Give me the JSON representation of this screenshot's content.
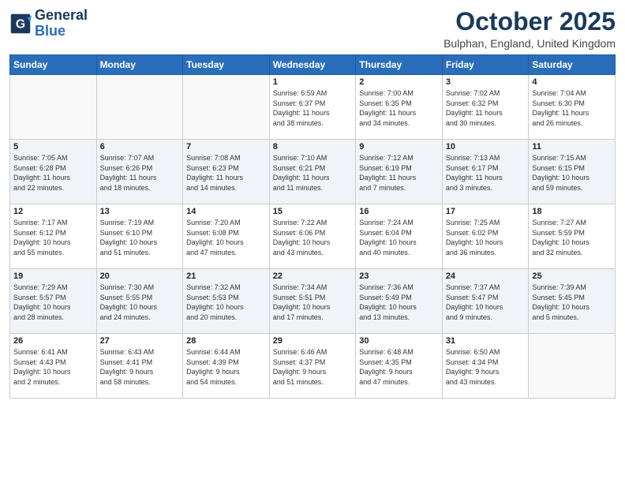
{
  "header": {
    "logo_line1": "General",
    "logo_line2": "Blue",
    "month": "October 2025",
    "location": "Bulphan, England, United Kingdom"
  },
  "weekdays": [
    "Sunday",
    "Monday",
    "Tuesday",
    "Wednesday",
    "Thursday",
    "Friday",
    "Saturday"
  ],
  "weeks": [
    [
      {
        "day": "",
        "info": ""
      },
      {
        "day": "",
        "info": ""
      },
      {
        "day": "",
        "info": ""
      },
      {
        "day": "1",
        "info": "Sunrise: 6:59 AM\nSunset: 6:37 PM\nDaylight: 11 hours\nand 38 minutes."
      },
      {
        "day": "2",
        "info": "Sunrise: 7:00 AM\nSunset: 6:35 PM\nDaylight: 11 hours\nand 34 minutes."
      },
      {
        "day": "3",
        "info": "Sunrise: 7:02 AM\nSunset: 6:32 PM\nDaylight: 11 hours\nand 30 minutes."
      },
      {
        "day": "4",
        "info": "Sunrise: 7:04 AM\nSunset: 6:30 PM\nDaylight: 11 hours\nand 26 minutes."
      }
    ],
    [
      {
        "day": "5",
        "info": "Sunrise: 7:05 AM\nSunset: 6:28 PM\nDaylight: 11 hours\nand 22 minutes."
      },
      {
        "day": "6",
        "info": "Sunrise: 7:07 AM\nSunset: 6:26 PM\nDaylight: 11 hours\nand 18 minutes."
      },
      {
        "day": "7",
        "info": "Sunrise: 7:08 AM\nSunset: 6:23 PM\nDaylight: 11 hours\nand 14 minutes."
      },
      {
        "day": "8",
        "info": "Sunrise: 7:10 AM\nSunset: 6:21 PM\nDaylight: 11 hours\nand 11 minutes."
      },
      {
        "day": "9",
        "info": "Sunrise: 7:12 AM\nSunset: 6:19 PM\nDaylight: 11 hours\nand 7 minutes."
      },
      {
        "day": "10",
        "info": "Sunrise: 7:13 AM\nSunset: 6:17 PM\nDaylight: 11 hours\nand 3 minutes."
      },
      {
        "day": "11",
        "info": "Sunrise: 7:15 AM\nSunset: 6:15 PM\nDaylight: 10 hours\nand 59 minutes."
      }
    ],
    [
      {
        "day": "12",
        "info": "Sunrise: 7:17 AM\nSunset: 6:12 PM\nDaylight: 10 hours\nand 55 minutes."
      },
      {
        "day": "13",
        "info": "Sunrise: 7:19 AM\nSunset: 6:10 PM\nDaylight: 10 hours\nand 51 minutes."
      },
      {
        "day": "14",
        "info": "Sunrise: 7:20 AM\nSunset: 6:08 PM\nDaylight: 10 hours\nand 47 minutes."
      },
      {
        "day": "15",
        "info": "Sunrise: 7:22 AM\nSunset: 6:06 PM\nDaylight: 10 hours\nand 43 minutes."
      },
      {
        "day": "16",
        "info": "Sunrise: 7:24 AM\nSunset: 6:04 PM\nDaylight: 10 hours\nand 40 minutes."
      },
      {
        "day": "17",
        "info": "Sunrise: 7:25 AM\nSunset: 6:02 PM\nDaylight: 10 hours\nand 36 minutes."
      },
      {
        "day": "18",
        "info": "Sunrise: 7:27 AM\nSunset: 5:59 PM\nDaylight: 10 hours\nand 32 minutes."
      }
    ],
    [
      {
        "day": "19",
        "info": "Sunrise: 7:29 AM\nSunset: 5:57 PM\nDaylight: 10 hours\nand 28 minutes."
      },
      {
        "day": "20",
        "info": "Sunrise: 7:30 AM\nSunset: 5:55 PM\nDaylight: 10 hours\nand 24 minutes."
      },
      {
        "day": "21",
        "info": "Sunrise: 7:32 AM\nSunset: 5:53 PM\nDaylight: 10 hours\nand 20 minutes."
      },
      {
        "day": "22",
        "info": "Sunrise: 7:34 AM\nSunset: 5:51 PM\nDaylight: 10 hours\nand 17 minutes."
      },
      {
        "day": "23",
        "info": "Sunrise: 7:36 AM\nSunset: 5:49 PM\nDaylight: 10 hours\nand 13 minutes."
      },
      {
        "day": "24",
        "info": "Sunrise: 7:37 AM\nSunset: 5:47 PM\nDaylight: 10 hours\nand 9 minutes."
      },
      {
        "day": "25",
        "info": "Sunrise: 7:39 AM\nSunset: 5:45 PM\nDaylight: 10 hours\nand 5 minutes."
      }
    ],
    [
      {
        "day": "26",
        "info": "Sunrise: 6:41 AM\nSunset: 4:43 PM\nDaylight: 10 hours\nand 2 minutes."
      },
      {
        "day": "27",
        "info": "Sunrise: 6:43 AM\nSunset: 4:41 PM\nDaylight: 9 hours\nand 58 minutes."
      },
      {
        "day": "28",
        "info": "Sunrise: 6:44 AM\nSunset: 4:39 PM\nDaylight: 9 hours\nand 54 minutes."
      },
      {
        "day": "29",
        "info": "Sunrise: 6:46 AM\nSunset: 4:37 PM\nDaylight: 9 hours\nand 51 minutes."
      },
      {
        "day": "30",
        "info": "Sunrise: 6:48 AM\nSunset: 4:35 PM\nDaylight: 9 hours\nand 47 minutes."
      },
      {
        "day": "31",
        "info": "Sunrise: 6:50 AM\nSunset: 4:34 PM\nDaylight: 9 hours\nand 43 minutes."
      },
      {
        "day": "",
        "info": ""
      }
    ]
  ]
}
